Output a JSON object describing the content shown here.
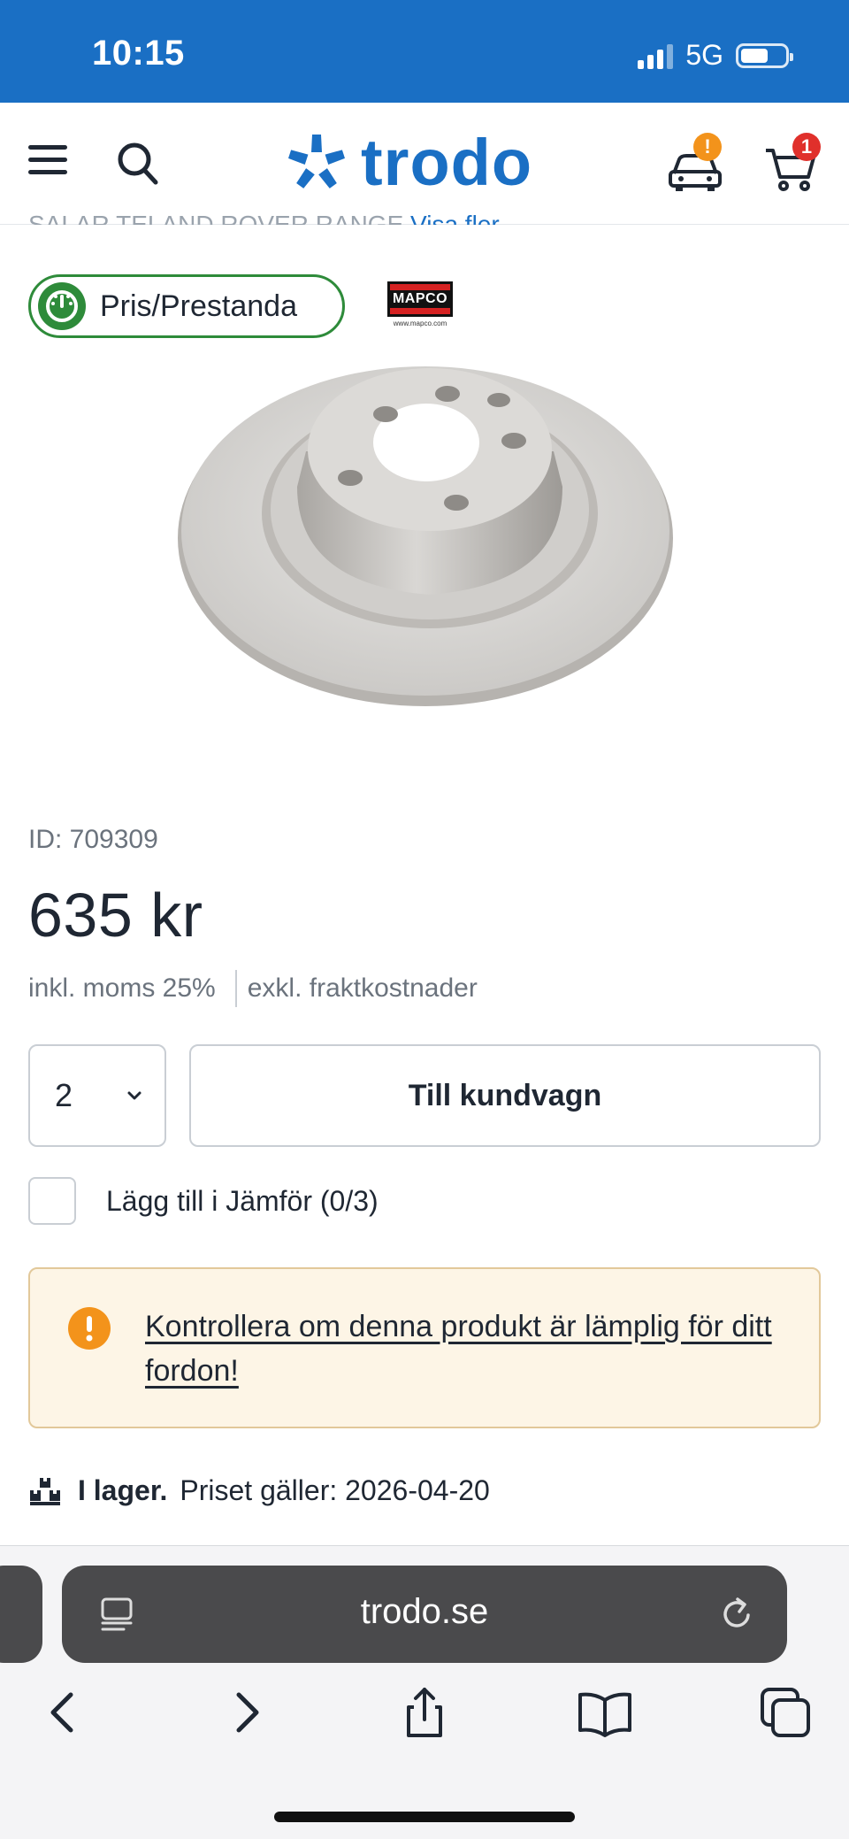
{
  "status_bar": {
    "time": "10:15",
    "network": "5G",
    "background_color": "#1a6fc4"
  },
  "header": {
    "menu_icon": "hamburger-menu-icon",
    "search_icon": "search-icon",
    "logo_text": "trodo",
    "logo_icon": "star-asterisk-icon",
    "brand_color": "#1a6fc4",
    "car_icon": "car-icon",
    "car_badge": "!",
    "cart_icon": "shopping-cart-icon",
    "cart_badge": "1"
  },
  "partial_text": {
    "text": "SALAR TELAND ROVER RANGE",
    "link": "Visa fler"
  },
  "rating_pill": {
    "label": "Pris/Prestanda",
    "icon": "speedometer-icon",
    "color": "#2e8b3a"
  },
  "brand": {
    "name": "MAPCO",
    "url": "www.mapco.com"
  },
  "product": {
    "image_icon": "brake-disc-image",
    "id_text": "ID: 709309",
    "price": "635 kr",
    "tax_note": "inkl. moms 25%",
    "shipping_note": "exkl. fraktkostnader"
  },
  "purchase": {
    "quantity": "2",
    "add_to_cart_label": "Till kundvagn"
  },
  "compare": {
    "label": "Lägg till i Jämför (0/3)",
    "checked": false
  },
  "alert": {
    "icon": "exclamation-circle-icon",
    "color": "#f3931b",
    "text": "Kontrollera om denna produkt är lämplig för ditt fordon!"
  },
  "stock": {
    "icon": "boxes-icon",
    "status": "I lager.",
    "price_valid": "Priset gäller: 2026-04-20"
  },
  "browser": {
    "url": "trodo.se",
    "toolbar": [
      "back-icon",
      "forward-icon",
      "share-icon",
      "bookmarks-icon",
      "tabs-icon"
    ]
  }
}
